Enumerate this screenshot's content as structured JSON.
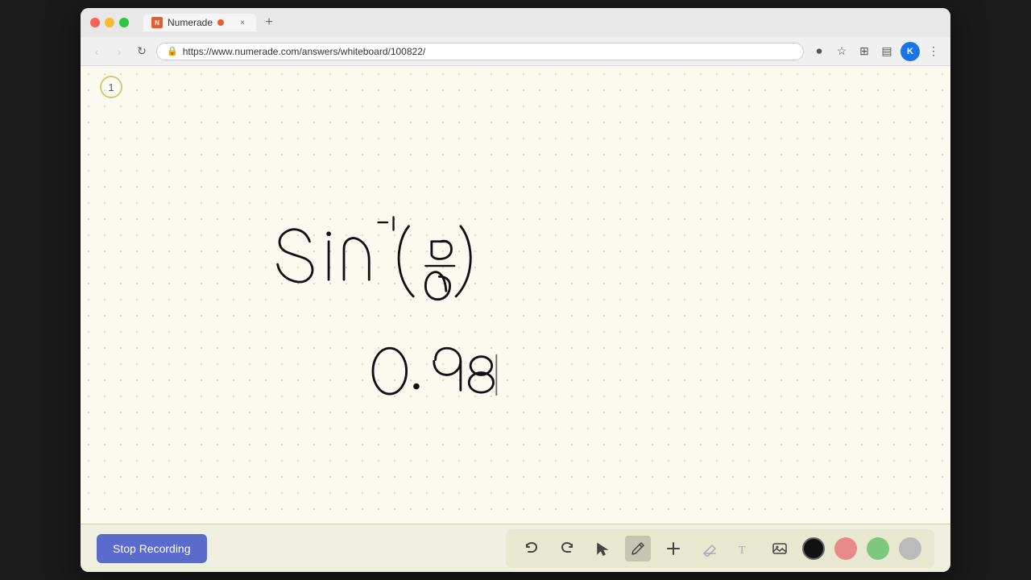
{
  "browser": {
    "tab_title": "Numerade",
    "tab_recording_active": true,
    "url": "https://www.numerade.com/answers/whiteboard/100822/",
    "new_tab_label": "+",
    "close_tab_label": "×"
  },
  "nav": {
    "back": "‹",
    "forward": "›",
    "refresh": "↻"
  },
  "toolbar_icons": {
    "screen_record": "⏺",
    "bookmark": "☆",
    "extensions": "⊞",
    "menu": "⋮"
  },
  "profile": {
    "initial": "K"
  },
  "whiteboard": {
    "page_number": "1",
    "math_expression": "sin⁻¹(5/6)",
    "result": "0.98"
  },
  "drawing_tools": {
    "undo_label": "↩",
    "redo_label": "↪",
    "select_label": "▷",
    "pen_label": "✏",
    "add_label": "+",
    "eraser_label": "/",
    "text_label": "T",
    "image_label": "🖼",
    "colors": [
      "#111111",
      "#e88a8a",
      "#7ec87e",
      "#bbbbbb"
    ]
  },
  "stop_recording_btn": {
    "label": "Stop Recording"
  }
}
